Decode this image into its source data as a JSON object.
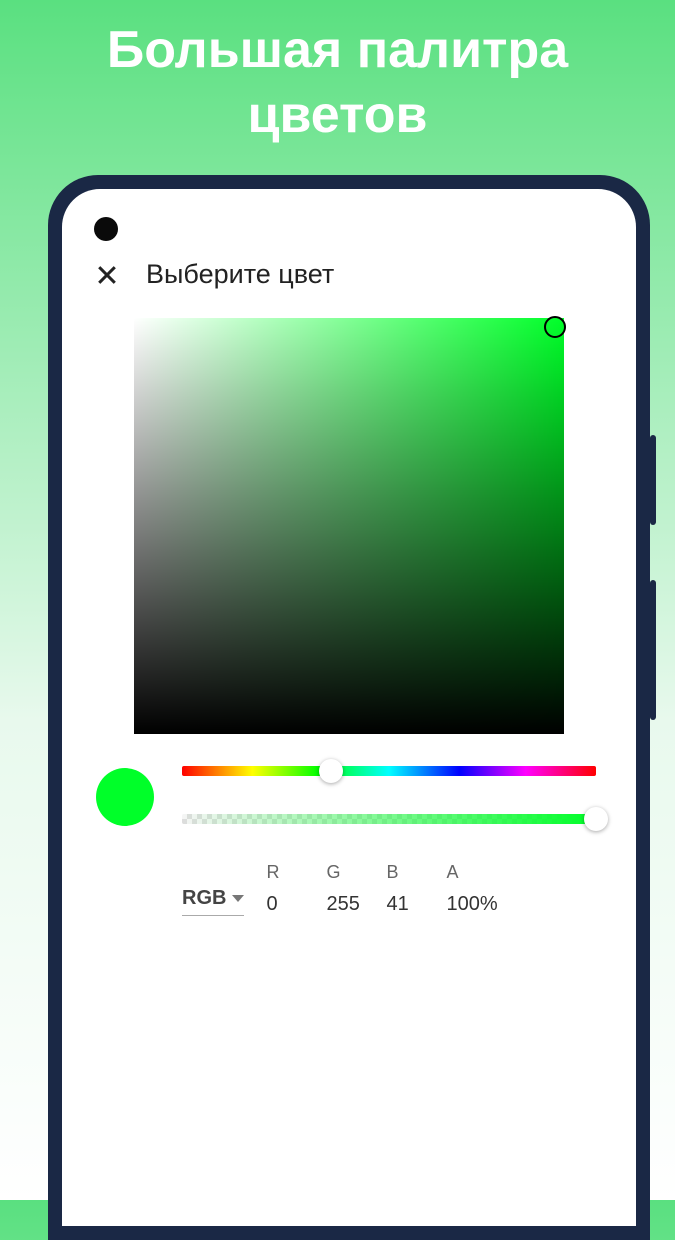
{
  "promo": {
    "title": "Большая палитра цветов"
  },
  "picker": {
    "title": "Выберите цвет",
    "selected_color": "#00ff29",
    "mode_label": "RGB",
    "channels": {
      "r": {
        "label": "R",
        "value": "0"
      },
      "g": {
        "label": "G",
        "value": "255"
      },
      "b": {
        "label": "B",
        "value": "41"
      },
      "a": {
        "label": "A",
        "value": "100%"
      }
    }
  }
}
